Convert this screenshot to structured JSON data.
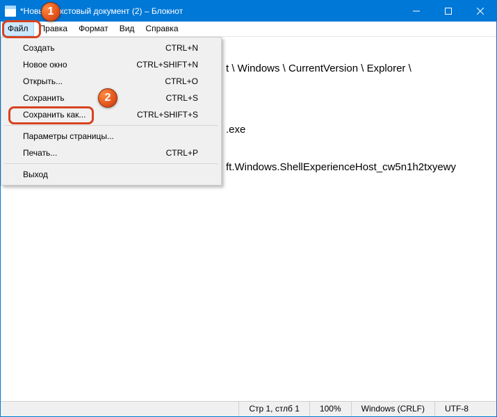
{
  "window": {
    "title": "*Новый текстовый документ (2) – Блокнот"
  },
  "menubar": {
    "items": [
      "Файл",
      "Правка",
      "Формат",
      "Вид",
      "Справка"
    ]
  },
  "dropdown": {
    "groups": [
      [
        {
          "label": "Создать",
          "shortcut": "CTRL+N"
        },
        {
          "label": "Новое окно",
          "shortcut": "CTRL+SHIFT+N"
        },
        {
          "label": "Открыть...",
          "shortcut": "CTRL+O"
        },
        {
          "label": "Сохранить",
          "shortcut": "CTRL+S"
        },
        {
          "label": "Сохранить как...",
          "shortcut": "CTRL+SHIFT+S"
        }
      ],
      [
        {
          "label": "Параметры страницы...",
          "shortcut": ""
        },
        {
          "label": "Печать...",
          "shortcut": "CTRL+P"
        }
      ],
      [
        {
          "label": "Выход",
          "shortcut": ""
        }
      ]
    ]
  },
  "editor": {
    "lines": [
      "t \\ Windows \\ CurrentVersion \\ Explorer \\",
      "",
      ".exe",
      "ft.Windows.ShellExperienceHost_cw5n1h2txyewy"
    ]
  },
  "statusbar": {
    "pos": "Стр 1, стлб 1",
    "zoom": "100%",
    "eol": "Windows (CRLF)",
    "enc": "UTF-8"
  },
  "annotations": {
    "badge1": "1",
    "badge2": "2"
  }
}
